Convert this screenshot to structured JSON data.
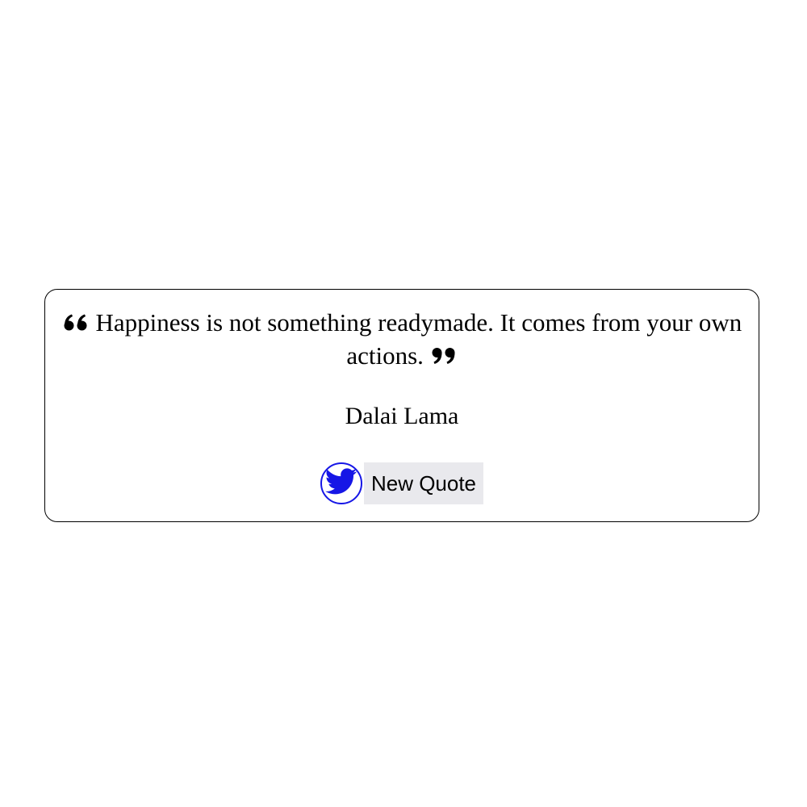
{
  "quote": {
    "text": "Happiness is not something readymade. It comes from your own actions.",
    "author": "Dalai Lama"
  },
  "actions": {
    "tweet_icon": "twitter-bird-icon",
    "new_quote_label": "New Quote"
  },
  "colors": {
    "tweet_accent": "#1616e6",
    "button_bg": "#e9e9ed",
    "border": "#000000"
  }
}
